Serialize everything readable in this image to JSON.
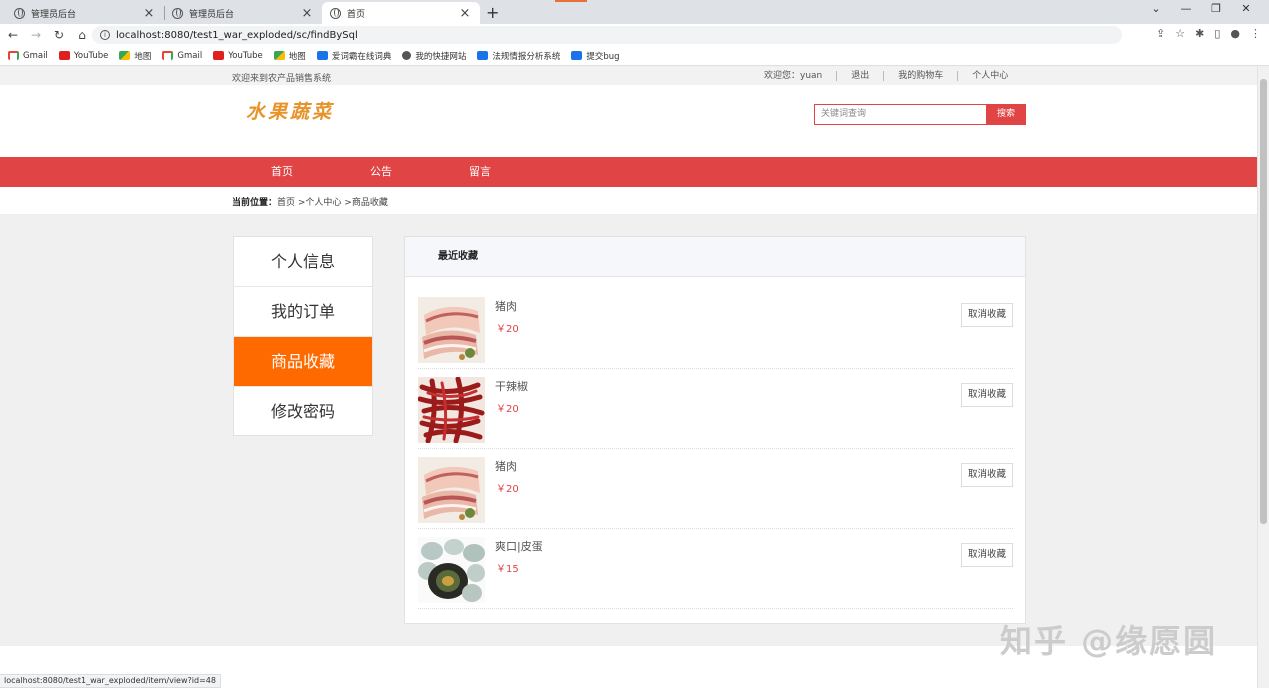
{
  "browser": {
    "tabs": [
      {
        "title": "管理员后台"
      },
      {
        "title": "管理员后台"
      },
      {
        "title": "首页"
      }
    ],
    "url": "localhost:8080/test1_war_exploded/sc/findBySql",
    "bookmarks": [
      {
        "label": "Gmail",
        "icon": "gmail"
      },
      {
        "label": "YouTube",
        "icon": "yt"
      },
      {
        "label": "地图",
        "icon": "map"
      },
      {
        "label": "Gmail",
        "icon": "gmail"
      },
      {
        "label": "YouTube",
        "icon": "yt"
      },
      {
        "label": "地图",
        "icon": "map"
      },
      {
        "label": "爱词霸在线词典",
        "icon": "blue"
      },
      {
        "label": "我的快捷网站",
        "icon": "globe"
      },
      {
        "label": "法规情报分析系统",
        "icon": "blue"
      },
      {
        "label": "提交bug",
        "icon": "blue"
      }
    ],
    "status_url": "localhost:8080/test1_war_exploded/item/view?id=48"
  },
  "topbar": {
    "welcome": "欢迎来到农产品销售系统",
    "user": "欢迎您：yuan",
    "logout": "退出",
    "cart": "我的购物车",
    "center": "个人中心"
  },
  "header": {
    "logo": "水果蔬菜",
    "search_placeholder": "关键词查询",
    "search_btn": "搜索"
  },
  "nav": {
    "home": "首页",
    "notice": "公告",
    "message": "留言"
  },
  "breadcrumb": {
    "label": "当前位置：",
    "path": "首页 >个人中心 >商品收藏"
  },
  "sidebar": {
    "items": [
      {
        "label": "个人信息"
      },
      {
        "label": "我的订单"
      },
      {
        "label": "商品收藏"
      },
      {
        "label": "修改密码"
      }
    ]
  },
  "favorites": {
    "title": "最近收藏",
    "unfav_label": "取消收藏",
    "items": [
      {
        "name": "猪肉",
        "price": "￥20"
      },
      {
        "name": "干辣椒",
        "price": "￥20"
      },
      {
        "name": "猪肉",
        "price": "￥20"
      },
      {
        "name": "爽口|皮蛋",
        "price": "￥15"
      }
    ]
  },
  "watermark": "知乎 @缘愿圆",
  "colors": {
    "accent": "#e04444",
    "active": "#ff6a00"
  }
}
